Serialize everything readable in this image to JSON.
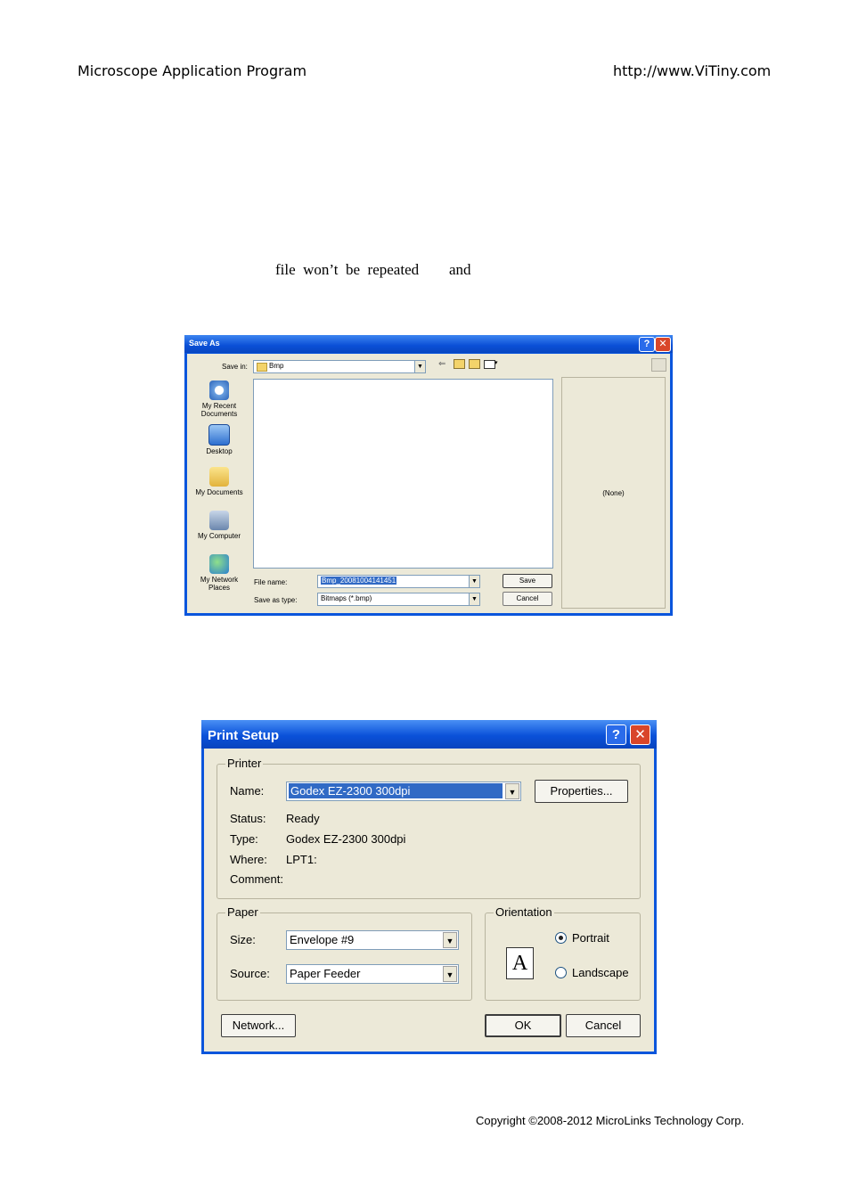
{
  "header": {
    "left": "Microscope Application Program",
    "right": "http://www.ViTiny.com"
  },
  "body_text": {
    "fragment": "file  won’t  be  repeated",
    "and": "and"
  },
  "save_as": {
    "title": "Save As",
    "save_in_label": "Save in:",
    "save_in_value": "Bmp",
    "places": [
      {
        "label": "My Recent Documents",
        "icon": "recent-documents-icon"
      },
      {
        "label": "Desktop",
        "icon": "desktop-icon"
      },
      {
        "label": "My Documents",
        "icon": "my-documents-icon"
      },
      {
        "label": "My Computer",
        "icon": "my-computer-icon"
      },
      {
        "label": "My Network Places",
        "icon": "network-places-icon"
      }
    ],
    "preview_text": "(None)",
    "file_name_label": "File name:",
    "file_name_value": "Bmp_20081004141451",
    "save_as_type_label": "Save as type:",
    "save_as_type_value": "Bitmaps (*.bmp)",
    "save_button": "Save",
    "cancel_button": "Cancel"
  },
  "print_setup": {
    "title": "Print Setup",
    "printer_group": "Printer",
    "name_label": "Name:",
    "name_value": "Godex EZ-2300 300dpi",
    "properties_button": "Properties...",
    "status_label": "Status:",
    "status_value": "Ready",
    "type_label": "Type:",
    "type_value": "Godex EZ-2300 300dpi",
    "where_label": "Where:",
    "where_value": "LPT1:",
    "comment_label": "Comment:",
    "comment_value": "",
    "paper_group": "Paper",
    "size_label": "Size:",
    "size_value": "Envelope #9",
    "source_label": "Source:",
    "source_value": "Paper Feeder",
    "orientation_group": "Orientation",
    "orientation_glyph": "A",
    "portrait_label": "Portrait",
    "landscape_label": "Landscape",
    "selected_orientation": "Portrait",
    "network_button": "Network...",
    "ok_button": "OK",
    "cancel_button": "Cancel"
  },
  "footer": {
    "copyright": "Copyright ©2008-2012 MicroLinks Technology Corp."
  }
}
